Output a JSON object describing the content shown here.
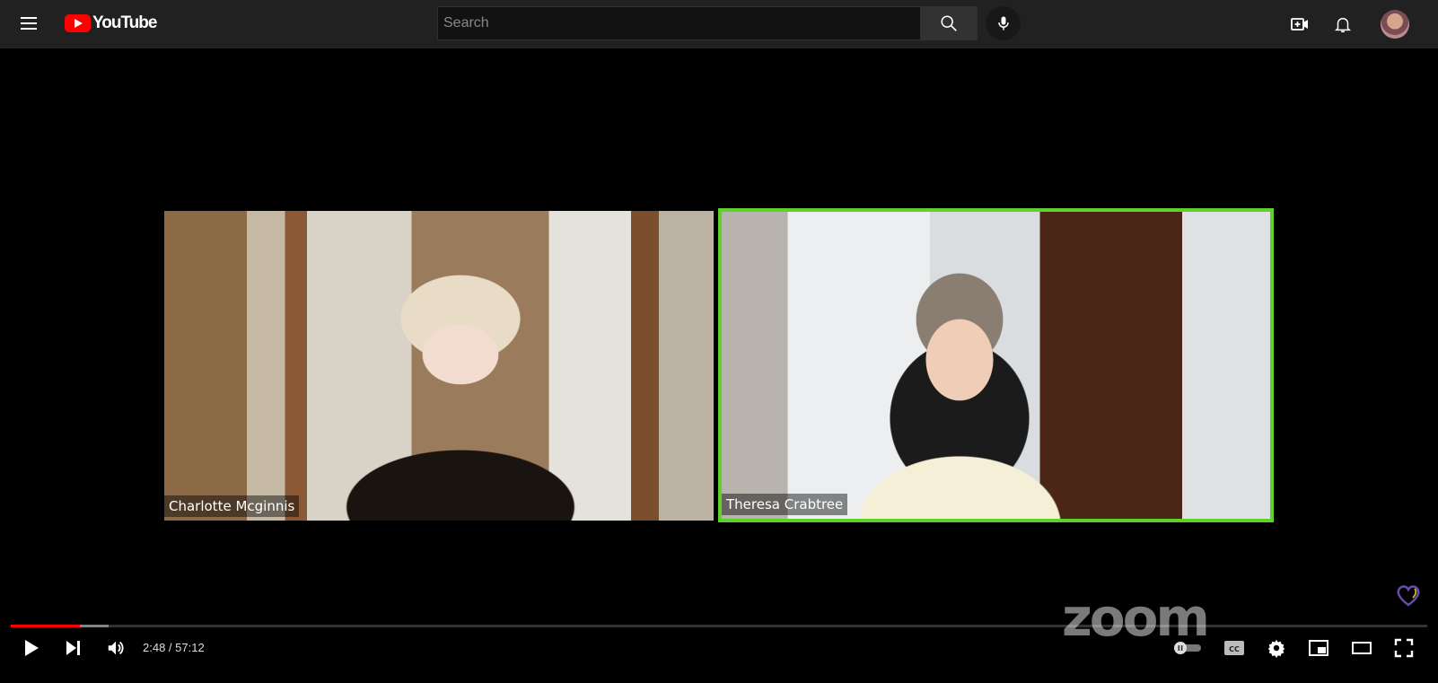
{
  "masthead": {
    "logo_text": "YouTube",
    "search_placeholder": "Search",
    "icons": [
      "menu-icon",
      "search-icon",
      "mic-icon",
      "create-video-icon",
      "notifications-bell-icon"
    ]
  },
  "video": {
    "participants": [
      {
        "name": "Charlotte Mcginnis",
        "active_speaker": false
      },
      {
        "name": "Theresa Crabtree",
        "active_speaker": true
      }
    ],
    "watermark": "zoom",
    "active_speaker_color": "#5fd229"
  },
  "player": {
    "current_time": "2:48",
    "duration": "57:12",
    "time_display": "2:48 / 57:12",
    "played_fraction": 0.049,
    "loaded_fraction": 0.069,
    "progress_color": "#ff0000",
    "autoplay": "off"
  }
}
